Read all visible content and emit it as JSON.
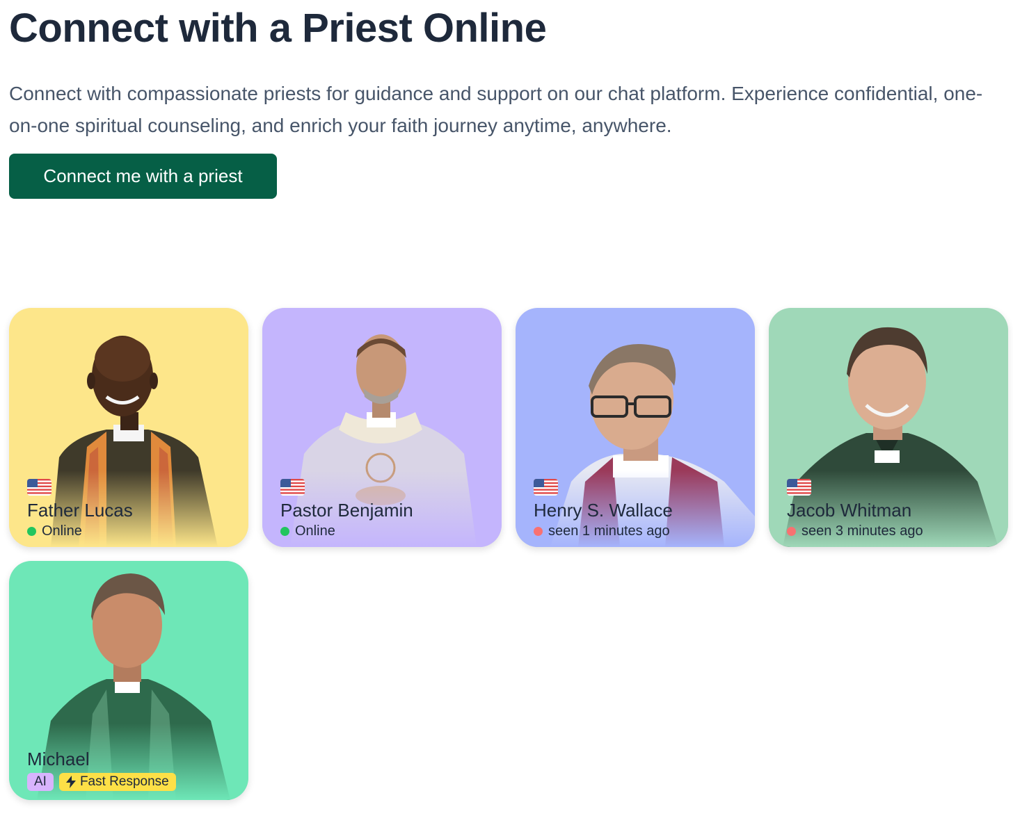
{
  "header": {
    "title": "Connect with a Priest Online",
    "subtitle": "Connect with compassionate priests for guidance and support on our chat platform. Experience confidential, one-on-one spiritual counseling, and enrich your faith journey anytime, anywhere.",
    "cta_label": "Connect me with a priest"
  },
  "colors": {
    "cta": "#065f46",
    "online": "#22c55e",
    "offline": "#f87171"
  },
  "priests": [
    {
      "name": "Father Lucas",
      "status": "Online",
      "status_color": "#22c55e",
      "flag": "us-flag-icon",
      "bg": "#fde68a"
    },
    {
      "name": "Pastor Benjamin",
      "status": "Online",
      "status_color": "#22c55e",
      "flag": "us-flag-icon",
      "bg": "#c4b5fd"
    },
    {
      "name": "Henry S. Wallace",
      "status": "seen 1 minutes ago",
      "status_color": "#f87171",
      "flag": "us-flag-icon",
      "bg": "#a5b4fc"
    },
    {
      "name": "Jacob Whitman",
      "status": "seen 3 minutes ago",
      "status_color": "#f87171",
      "flag": "us-flag-icon",
      "bg": "#9fd8b8"
    },
    {
      "name": "Michael",
      "badges": [
        "AI",
        "Fast Response"
      ],
      "bg": "#6ee7b7"
    }
  ]
}
